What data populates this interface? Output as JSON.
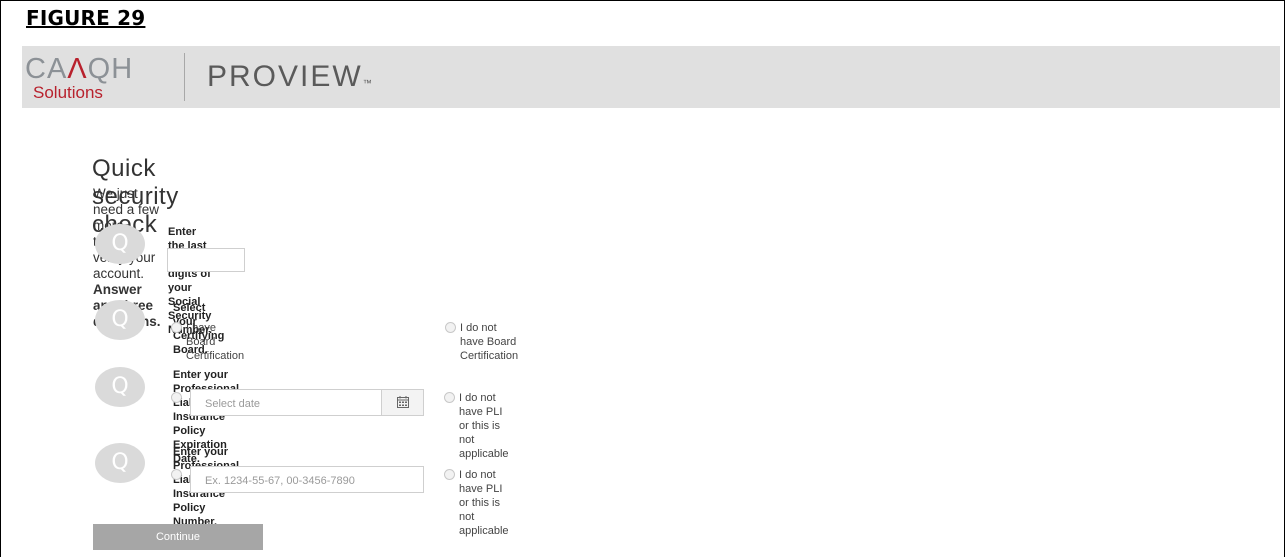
{
  "figure_label": "FIGURE 29",
  "header": {
    "logo_main": "CAQH",
    "logo_main_pre": "CA",
    "logo_main_accent": "Λ",
    "logo_main_post": "QH",
    "logo_sub": "Solutions",
    "product": "PROVIEW",
    "trademark": "™"
  },
  "page": {
    "title": "Quick security check",
    "subtitle_plain": "We just need a few more things to verify your account.",
    "subtitle_bold": "Answer any three questions."
  },
  "questions": [
    {
      "icon": "Q",
      "label": "Enter the last four digits of your Social Security Number.",
      "input_value": ""
    },
    {
      "icon": "Q",
      "label": "Select your Certifying Board.",
      "options": [
        "I have Board Certification",
        "I do not have Board Certification"
      ]
    },
    {
      "icon": "Q",
      "label": "Enter your Professional Liability Insurance Policy Expiration Date.",
      "placeholder": "Select date",
      "icon_name": "calendar-icon",
      "alt_option": "I do not have PLI or this is not applicable"
    },
    {
      "icon": "Q",
      "label": "Enter your Professional Liabilty Insurance Policy Number.",
      "placeholder": "Ex. 1234-55-67, 00-3456-7890",
      "alt_option": "I do not have PLI or this is not applicable"
    }
  ],
  "continue_label": "Continue",
  "colors": {
    "header_bg": "#e0e0e0",
    "brand_red": "#b8212d",
    "brand_gray": "#8c9196",
    "button_gray": "#a6a6a6",
    "icon_gray": "#dadada"
  }
}
